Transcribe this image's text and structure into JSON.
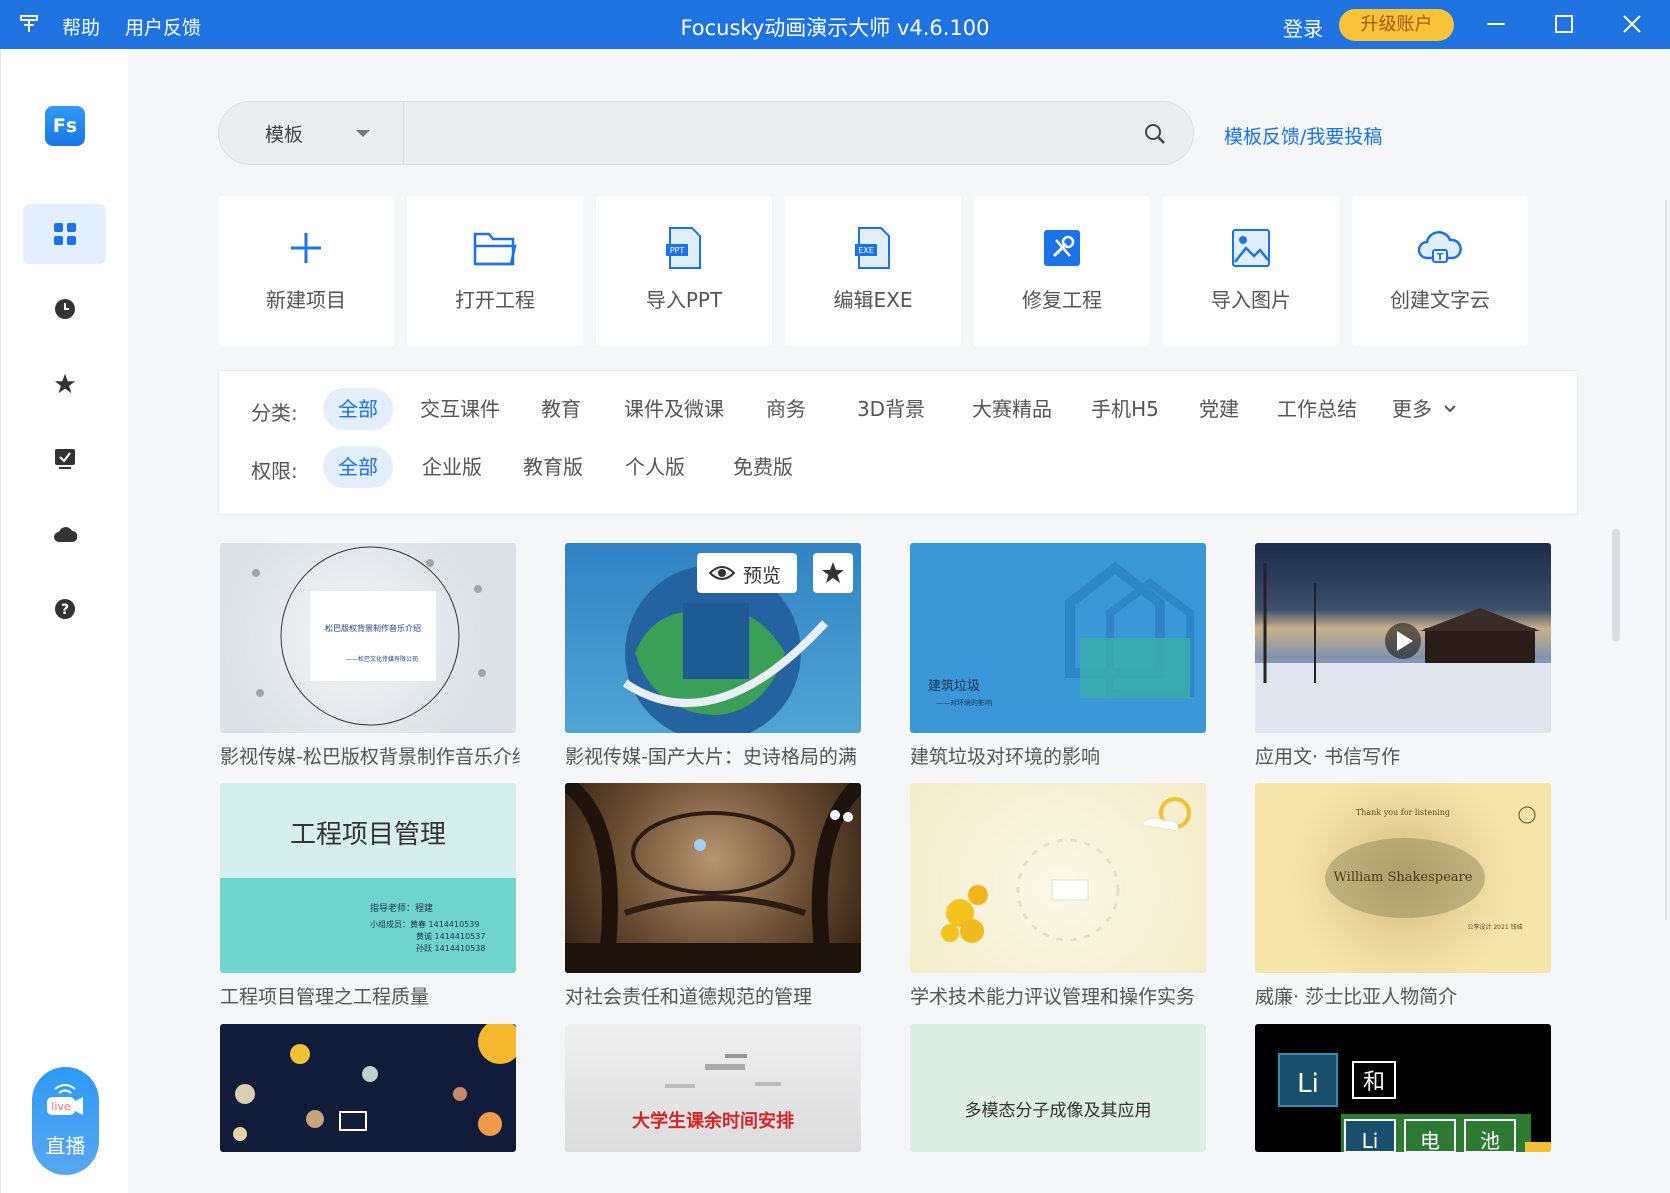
{
  "titlebar": {
    "app_icon": "pin-icon",
    "menu_help": "帮助",
    "menu_feedback": "用户反馈",
    "title": "Focusky动画演示大师 v4.6.100",
    "login": "登录",
    "upgrade": "升级账户",
    "brand_color": "#1e73e0"
  },
  "sidebar": {
    "logo": "Fs",
    "items": [
      {
        "icon": "grid-icon",
        "active": true
      },
      {
        "icon": "clock-icon"
      },
      {
        "icon": "star-icon"
      },
      {
        "icon": "task-check-icon"
      },
      {
        "icon": "cloud-icon"
      },
      {
        "icon": "help-icon"
      }
    ],
    "live": {
      "badge": "live",
      "label": "直播"
    }
  },
  "search": {
    "type_label": "模板",
    "placeholder": "",
    "link": "模板反馈/我要投稿"
  },
  "actions": [
    {
      "label": "新建项目",
      "icon": "plus-icon"
    },
    {
      "label": "打开工程",
      "icon": "folder-icon"
    },
    {
      "label": "导入PPT",
      "icon": "ppt-file-icon"
    },
    {
      "label": "编辑EXE",
      "icon": "exe-file-icon"
    },
    {
      "label": "修复工程",
      "icon": "repair-tools-icon"
    },
    {
      "label": "导入图片",
      "icon": "image-icon"
    },
    {
      "label": "创建文字云",
      "icon": "word-cloud-icon"
    }
  ],
  "filters": {
    "category_label": "分类:",
    "categories": [
      "全部",
      "交互课件",
      "教育",
      "课件及微课",
      "商务",
      "3D背景",
      "大赛精品",
      "手机H5",
      "党建",
      "工作总结",
      "更多"
    ],
    "permission_label": "权限:",
    "permissions": [
      "全部",
      "企业版",
      "教育版",
      "个人版",
      "免费版"
    ]
  },
  "templates": [
    {
      "title": "影视传媒-松巴版权背景制作音乐介绍",
      "thumb_text": "松巴版权背景制作音乐介绍",
      "thumb_sub": "——松巴文化传媒有限公司",
      "colors": [
        "#e6ebee",
        "#c9d2d8"
      ]
    },
    {
      "title": "影视传媒-国产大片：史诗格局的满",
      "thumb_text": "",
      "colors": [
        "#2f83c4",
        "#5ab1d6"
      ],
      "preview_label": "预览"
    },
    {
      "title": "建筑垃圾对环境的影响",
      "thumb_text": "建筑垃圾",
      "thumb_sub": "——对环境的影响",
      "colors": [
        "#3a97d8",
        "#3a97d8"
      ]
    },
    {
      "title": "应用文· 书信写作",
      "thumb_text": "",
      "colors": [
        "#1b2b4a",
        "#6d7d98"
      ]
    },
    {
      "title": "工程项目管理之工程质量",
      "thumb_text": "工程项目管理",
      "thumb_sub": "指导老师：程建",
      "thumb_lines": [
        "小组成员：黄春 1414410539",
        "黄诚 1414410537",
        "孙跃 1414410538"
      ],
      "colors": [
        "#d5efec",
        "#6fd4cc"
      ]
    },
    {
      "title": "对社会责任和道德规范的管理",
      "thumb_text": "",
      "colors": [
        "#3a2818",
        "#8a6a48"
      ]
    },
    {
      "title": "学术技术能力评议管理和操作实务",
      "thumb_text": "",
      "colors": [
        "#f6f2dc",
        "#f1e9c4"
      ]
    },
    {
      "title": "威廉· 莎士比亚人物简介",
      "thumb_text": "William Shakespeare",
      "thumb_sub": "Thank you for listening",
      "thumb_credit": "公李设计 2021 钱城",
      "colors": [
        "#f6e5a8",
        "#efd98f"
      ]
    },
    {
      "title": "",
      "thumb_text": "",
      "colors": [
        "#111b3a",
        "#1d2b55"
      ]
    },
    {
      "title": "",
      "thumb_text": "大学生课余时间安排",
      "colors": [
        "#e9e9e9",
        "#d9d9d9"
      ]
    },
    {
      "title": "",
      "thumb_text": "多模态分子成像及其应用",
      "colors": [
        "#dcefe2",
        "#dcefe2"
      ]
    },
    {
      "title": "",
      "thumb_text": "和",
      "thumb_li": "Li",
      "thumb_row": [
        "Li",
        "电",
        "池"
      ],
      "colors": [
        "#000000",
        "#0a0a0a"
      ]
    }
  ]
}
